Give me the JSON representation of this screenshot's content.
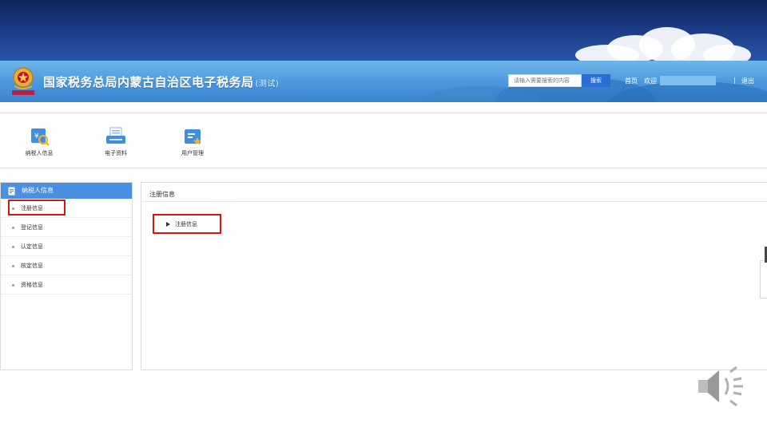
{
  "header": {
    "site_title": "国家税务总局内蒙古自治区电子税务局",
    "test_tag": "(测试)",
    "search_placeholder": "请输入需要搜索的内容",
    "search_button": "搜索",
    "home": "首页",
    "welcome": "欢迎",
    "separator": "|",
    "logout": "退出"
  },
  "toolbar": {
    "items": [
      {
        "label": "纳税人信息",
        "icon": "taxpayer-info-icon"
      },
      {
        "label": "电子资料",
        "icon": "e-documents-icon"
      },
      {
        "label": "用户管理",
        "icon": "user-management-icon"
      }
    ]
  },
  "sidebar": {
    "title": "纳税人信息",
    "items": [
      {
        "label": "注册信息"
      },
      {
        "label": "登记信息"
      },
      {
        "label": "认定信息"
      },
      {
        "label": "核定信息"
      },
      {
        "label": "资格信息"
      }
    ]
  },
  "main": {
    "heading": "注册信息",
    "link": "注册信息"
  },
  "colors": {
    "sidebar_header": "#4a90e2",
    "highlight": "#d61414",
    "search_button": "#2b6ed3"
  }
}
